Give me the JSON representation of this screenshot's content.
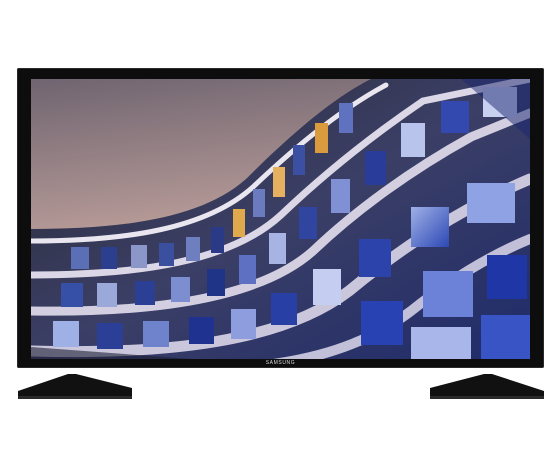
{
  "brand_label": "SAMSUNG",
  "colors": {
    "bezel": "#0d0d0d",
    "sky_top": "#8e7d86",
    "sky_bottom": "#c9a995",
    "window_blue": "#2f4fb0",
    "window_warm": "#e0a94c",
    "facade_light": "#c9c6d8"
  }
}
